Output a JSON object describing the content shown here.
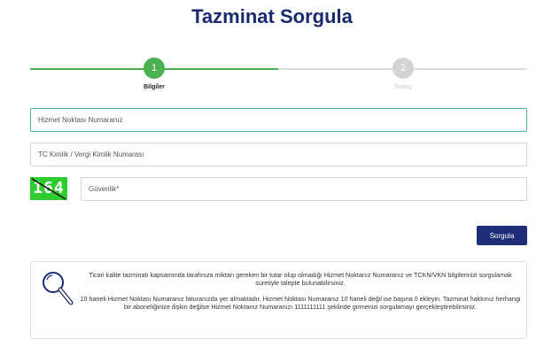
{
  "page": {
    "title": "Tazminat Sorgula"
  },
  "stepper": {
    "steps": [
      {
        "number": "1",
        "label": "Bilgiler"
      },
      {
        "number": "2",
        "label": "Sonuç"
      }
    ]
  },
  "form": {
    "service_point_placeholder": "Hizmet Noktası Numaranız",
    "tckn_placeholder": "TC Kimlik / Vergi Kimlik Numarası",
    "security_placeholder": "Güvenlik*",
    "captcha_code": "164",
    "submit_label": "Sorgula"
  },
  "info": {
    "paragraph_1": "Ticari kalite tazminatı kapsamında tarafınıza miktarı gereken bir tutar olup olmadığı Hizmet Noktanız Numaranız ve TCKN/VKN bilgilerinizi sorgulamak suretiyle talepte bulunabilirsiniz.",
    "paragraph_2": "10 haneli Hizmet Noktası Numaranız faturanızda yer almaktadır. Hizmet Noktası Numaranız 10 haneli değil ise başına 0 ekleyin. Tazminat hakkınız herhangi bir aboneliğinize ilişkin değilse Hizmet Noktanız Numaranızı 1111111111 şeklinde girmenizi sorgulamayı gerçekleştirebilirsiniz.",
    "icon": "magnifier-icon"
  },
  "colors": {
    "title": "#1b2a6e",
    "step_active": "#4caf50",
    "step_inactive": "#d4d4d4",
    "button": "#1e2e78",
    "captcha_bg": "#2ecc2e",
    "focus_border": "#56b0b3"
  }
}
